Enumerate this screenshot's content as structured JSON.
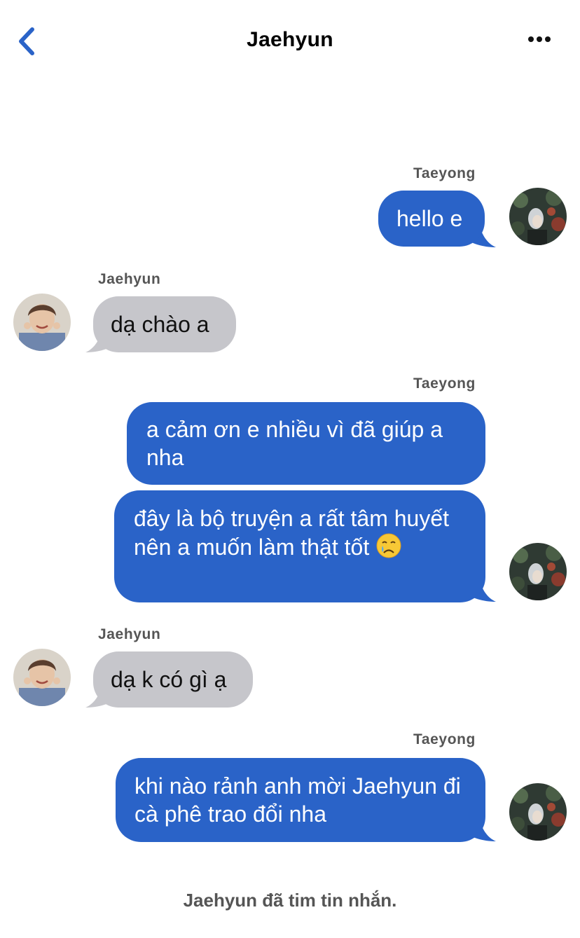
{
  "header": {
    "title": "Jaehyun",
    "back_icon": "chevron-left-icon",
    "more_icon": "ellipsis-icon",
    "accent_color": "#2a63c8"
  },
  "messages": [
    {
      "sender": "Taeyong",
      "direction": "outgoing",
      "text": "hello e"
    },
    {
      "sender": "Jaehyun",
      "direction": "incoming",
      "text": "dạ chào a"
    },
    {
      "sender": "Taeyong",
      "direction": "outgoing",
      "text": "a cảm ơn e nhiều vì đã giúp a nha"
    },
    {
      "sender": "Taeyong",
      "direction": "outgoing",
      "text": "đây là bộ truyện a rất tâm huyết nên a muốn làm thật tốt",
      "emoji": "crying-face-icon"
    },
    {
      "sender": "Jaehyun",
      "direction": "incoming",
      "text": "dạ k có gì ạ"
    },
    {
      "sender": "Taeyong",
      "direction": "outgoing",
      "text": "khi nào rảnh anh mời Jaehyun đi cà phê trao đổi nha"
    }
  ],
  "senders": {
    "s1": "Taeyong",
    "s2": "Jaehyun",
    "s3": "Taeyong",
    "s4": "Jaehyun",
    "s5": "Taeyong"
  },
  "footer": {
    "reaction_note": "Jaehyun đã tim tin nhắn."
  },
  "colors": {
    "outgoing_bubble": "#2a63c8",
    "incoming_bubble": "#c6c6cb",
    "sender_label": "#555555"
  }
}
